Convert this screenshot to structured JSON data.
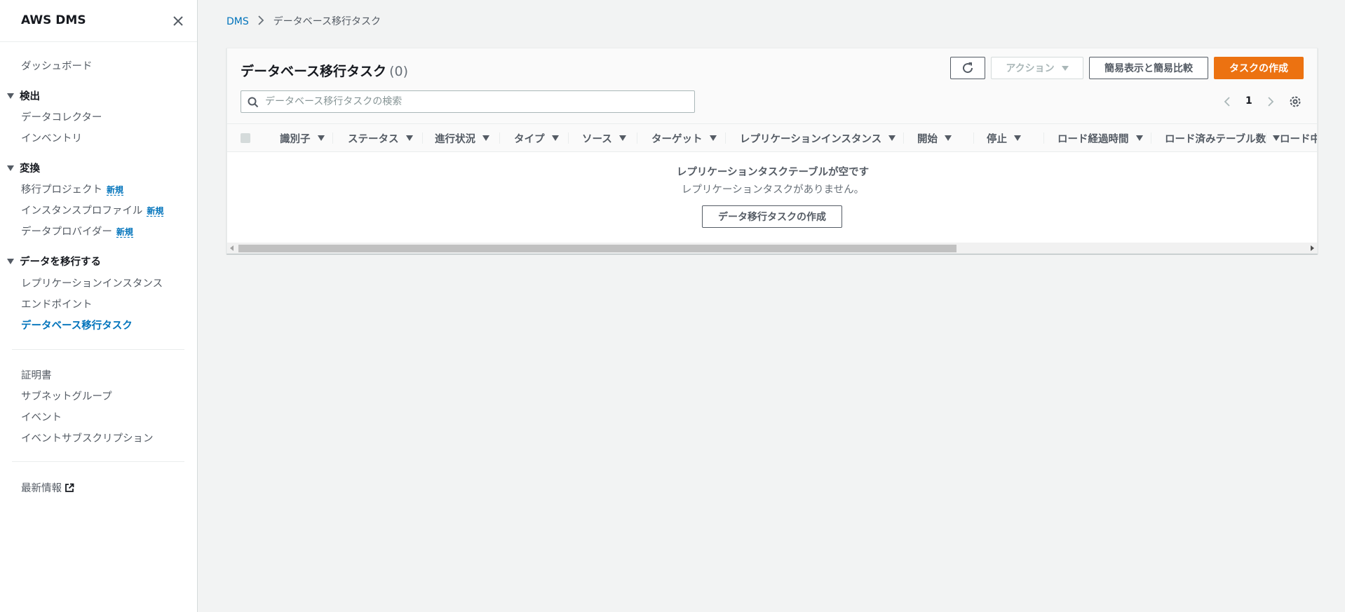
{
  "sidebar": {
    "title": "AWS DMS",
    "dashboard": "ダッシュボード",
    "sections": {
      "discover": {
        "label": "検出",
        "items": [
          "データコレクター",
          "インベントリ"
        ]
      },
      "convert": {
        "label": "変換",
        "items": [
          "移行プロジェクト",
          "インスタンスプロファイル",
          "データプロバイダー"
        ],
        "new_badge": "新規"
      },
      "migrate": {
        "label": "データを移行する",
        "items": [
          "レプリケーションインスタンス",
          "エンドポイント",
          "データベース移行タスク"
        ]
      }
    },
    "misc_items": [
      "証明書",
      "サブネットグループ",
      "イベント",
      "イベントサブスクリプション"
    ],
    "whats_new": "最新情報"
  },
  "breadcrumb": {
    "root": "DMS",
    "current": "データベース移行タスク"
  },
  "panel": {
    "title": "データベース移行タスク",
    "count": "(0)",
    "buttons": {
      "actions": "アクション",
      "simple_view": "簡易表示と簡易比較",
      "create_task": "タスクの作成"
    },
    "search_placeholder": "データベース移行タスクの検索",
    "page_number": "1"
  },
  "table": {
    "columns": [
      "識別子",
      "ステータス",
      "進行状況",
      "タイプ",
      "ソース",
      "ターゲット",
      "レプリケーションインスタンス",
      "開始",
      "停止",
      "ロード経過時間",
      "ロード済みテーブル数",
      "ロード中"
    ],
    "empty_title": "レプリケーションタスクテーブルが空です",
    "empty_subtitle": "レプリケーションタスクがありません。",
    "empty_button": "データ移行タスクの作成"
  },
  "colors": {
    "accent": "#ec7211",
    "link": "#0073bb"
  }
}
